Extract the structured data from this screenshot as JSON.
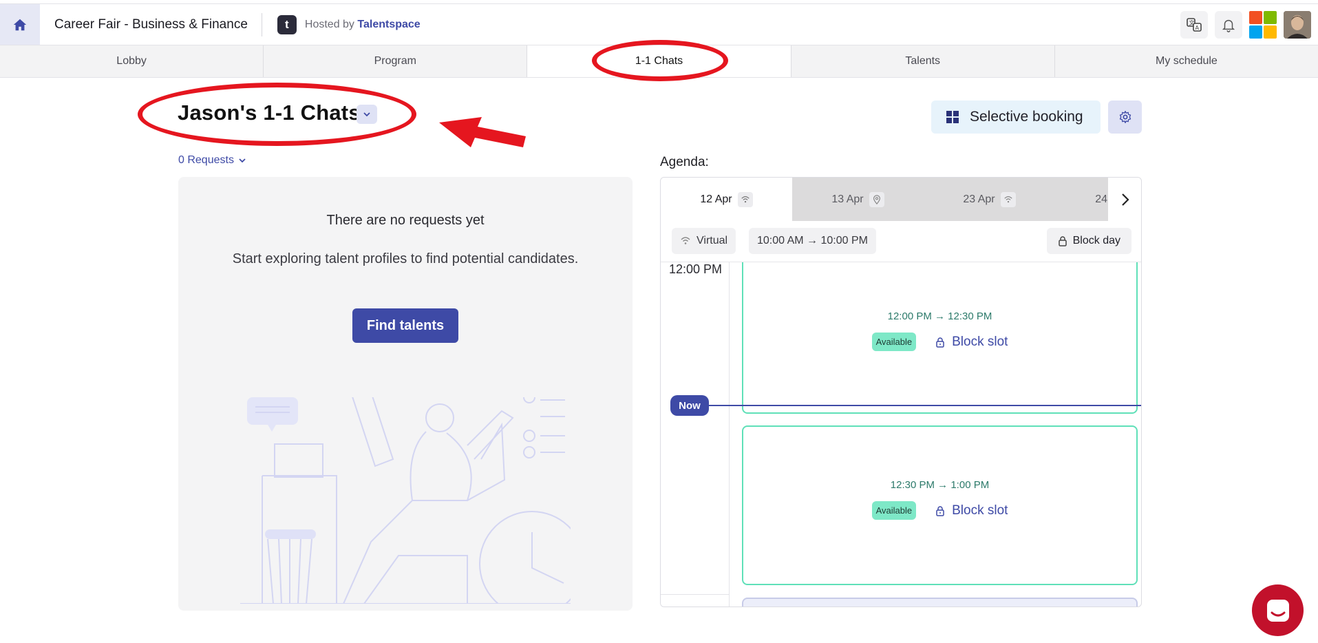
{
  "header": {
    "event_title": "Career Fair - Business & Finance",
    "host_logo_letter": "t",
    "hosted_prefix": "Hosted by",
    "hosted_brand": "Talentspace",
    "icons": [
      "home-icon",
      "translate-icon",
      "bell-icon",
      "microsoft-logo",
      "user-avatar"
    ]
  },
  "tabs": [
    {
      "label": "Lobby",
      "active": false
    },
    {
      "label": "Program",
      "active": false
    },
    {
      "label": "1-1 Chats",
      "active": true
    },
    {
      "label": "Talents",
      "active": false
    },
    {
      "label": "My schedule",
      "active": false
    }
  ],
  "page": {
    "title": "Jason's 1-1 Chats",
    "requests_label": "0 Requests",
    "selective_booking_label": "Selective booking"
  },
  "requests_panel": {
    "empty_title": "There are no requests yet",
    "empty_text": "Start exploring talent profiles to find potential candidates.",
    "find_button": "Find talents"
  },
  "agenda": {
    "label": "Agenda:",
    "days": [
      {
        "label": "12 Apr",
        "icon": "wifi-icon",
        "active": true
      },
      {
        "label": "13 Apr",
        "icon": "location-pin-icon",
        "active": false
      },
      {
        "label": "23 Apr",
        "icon": "wifi-icon",
        "active": false
      },
      {
        "label": "24",
        "icon": "",
        "active": false
      }
    ],
    "mode_chip": "Virtual",
    "hours_chip": "10:00 AM → 10:00 PM",
    "block_day_label": "Block day",
    "time_label": "12:00 PM",
    "now_label": "Now",
    "slots": [
      {
        "time": "12:00 PM → 12:30 PM",
        "status": "Available",
        "action": "Block slot"
      },
      {
        "time": "12:30 PM → 1:00 PM",
        "status": "Available",
        "action": "Block slot"
      }
    ]
  },
  "colors": {
    "brand": "#3e4aa6",
    "annotation_red": "#e5161f",
    "available_green": "#7ee8c7",
    "slot_border": "#5fe0b8",
    "chat_widget": "#c2112b"
  }
}
